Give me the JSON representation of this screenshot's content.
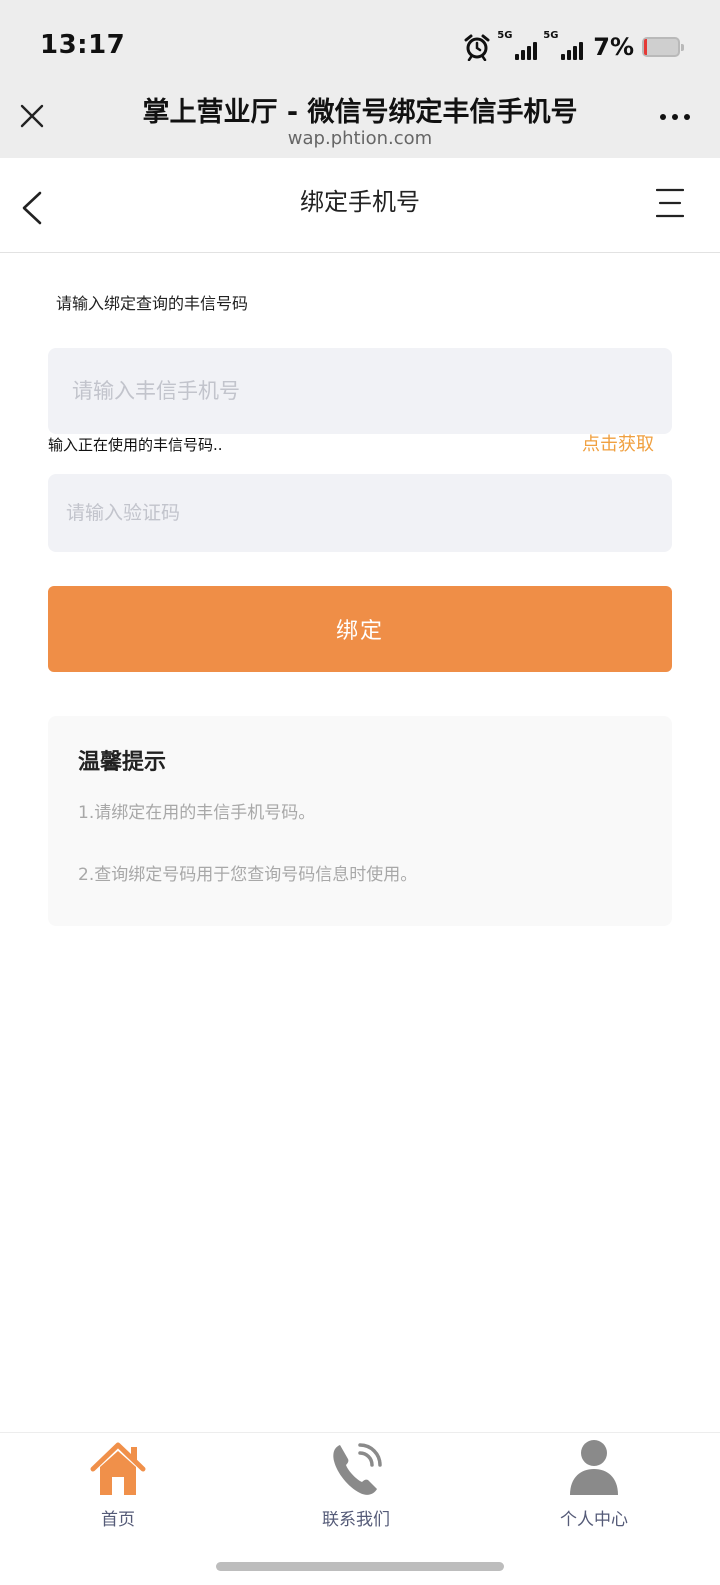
{
  "status_bar": {
    "time": "13:17",
    "network_1": "5G",
    "network_2": "5G",
    "battery_percent_label": "7%",
    "battery_level": 0.07
  },
  "browser": {
    "title": "掌上营业厅 - 微信号绑定丰信手机号",
    "url": "wap.phtion.com"
  },
  "nav": {
    "title": "绑定手机号"
  },
  "form": {
    "hint": "请输入绑定查询的丰信号码",
    "phone_placeholder": "请输入丰信手机号",
    "phone_value": "",
    "sub_hint": "输入正在使用的丰信号码..",
    "get_code_label": "点击获取",
    "code_placeholder": "请输入验证码",
    "code_value": "",
    "bind_label": "绑定"
  },
  "tips": {
    "title": "温馨提示",
    "lines": [
      "1.请绑定在用的丰信手机号码。",
      "2.查询绑定号码用于您查询号码信息时使用。"
    ]
  },
  "tabbar": {
    "items": [
      {
        "label": "首页",
        "icon": "home-icon",
        "color": "#f0904a"
      },
      {
        "label": "联系我们",
        "icon": "phone-icon",
        "color": "#8a8a8a"
      },
      {
        "label": "个人中心",
        "icon": "user-icon",
        "color": "#8a8a8a"
      }
    ]
  },
  "colors": {
    "accent": "#ef8e47",
    "link": "#f0a040",
    "input_bg": "#f1f2f6",
    "chrome_bg": "#ededed"
  }
}
